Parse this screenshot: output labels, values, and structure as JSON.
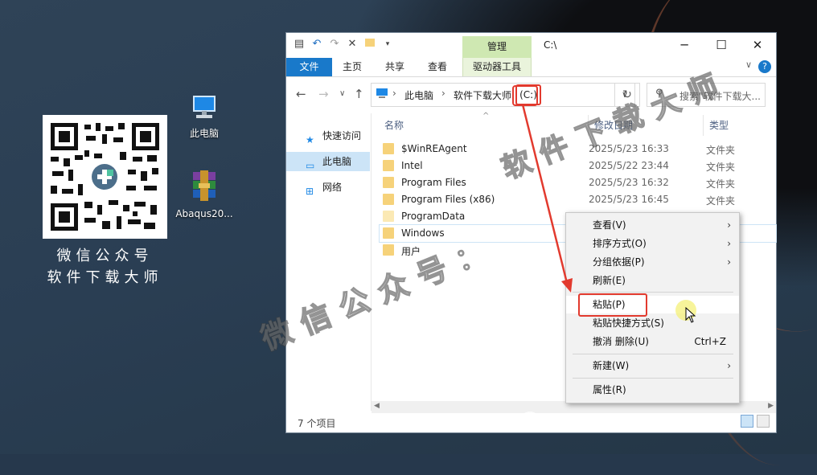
{
  "desktop": {
    "qr_caption_line1": "微信公众号",
    "qr_caption_line2": "软件下载大师",
    "icons": [
      {
        "label": "此电脑",
        "icon": "computer-icon"
      },
      {
        "label": "Abaqus20...",
        "icon": "winrar-archive-icon"
      }
    ]
  },
  "window": {
    "title": "C:\\",
    "contextual_tab_group": "管理",
    "tabs": [
      "文件",
      "主页",
      "共享",
      "查看",
      "驱动器工具"
    ],
    "breadcrumb": [
      "此电脑",
      "软件下载大师",
      "(C:)"
    ],
    "search_placeholder": "搜索\"软件下载大...",
    "nav_pane": [
      {
        "label": "快速访问",
        "icon": "star-icon",
        "selected": false
      },
      {
        "label": "此电脑",
        "icon": "computer-icon",
        "selected": true
      },
      {
        "label": "网络",
        "icon": "network-icon",
        "selected": false
      }
    ],
    "columns": [
      "名称",
      "修改日期",
      "类型"
    ],
    "files": [
      {
        "name": "$WinREAgent",
        "date": "2025/5/23 16:33",
        "type": "文件夹"
      },
      {
        "name": "Intel",
        "date": "2025/5/22 23:44",
        "type": "文件夹"
      },
      {
        "name": "Program Files",
        "date": "2025/5/23 16:32",
        "type": "文件夹"
      },
      {
        "name": "Program Files (x86)",
        "date": "2025/5/23 16:45",
        "type": "文件夹"
      },
      {
        "name": "ProgramData",
        "date": "",
        "type": ""
      },
      {
        "name": "Windows",
        "date": "",
        "type": ""
      },
      {
        "name": "用户",
        "date": "",
        "type": ""
      }
    ],
    "status": "7 个项目"
  },
  "context_menu": {
    "items": [
      {
        "label": "查看(V)",
        "submenu": true
      },
      {
        "label": "排序方式(O)",
        "submenu": true
      },
      {
        "label": "分组依据(P)",
        "submenu": true
      },
      {
        "label": "刷新(E)",
        "submenu": false
      },
      {
        "label": "粘贴(P)",
        "submenu": false
      },
      {
        "label": "粘贴快捷方式(S)",
        "submenu": false
      },
      {
        "label": "撤消 删除(U)",
        "shortcut": "Ctrl+Z"
      },
      {
        "label": "新建(W)",
        "submenu": true
      },
      {
        "label": "属性(R)",
        "submenu": false
      }
    ]
  },
  "watermark": {
    "line1": "软件下载大师",
    "line2": "微信公众号：",
    "bottom": "公众号 · 软件下载大师"
  },
  "colors": {
    "file_tab": "#1979ca",
    "manage_tab": "#cfe8b2",
    "highlight_box": "#e23a2e",
    "selection": "#cce4f7"
  }
}
